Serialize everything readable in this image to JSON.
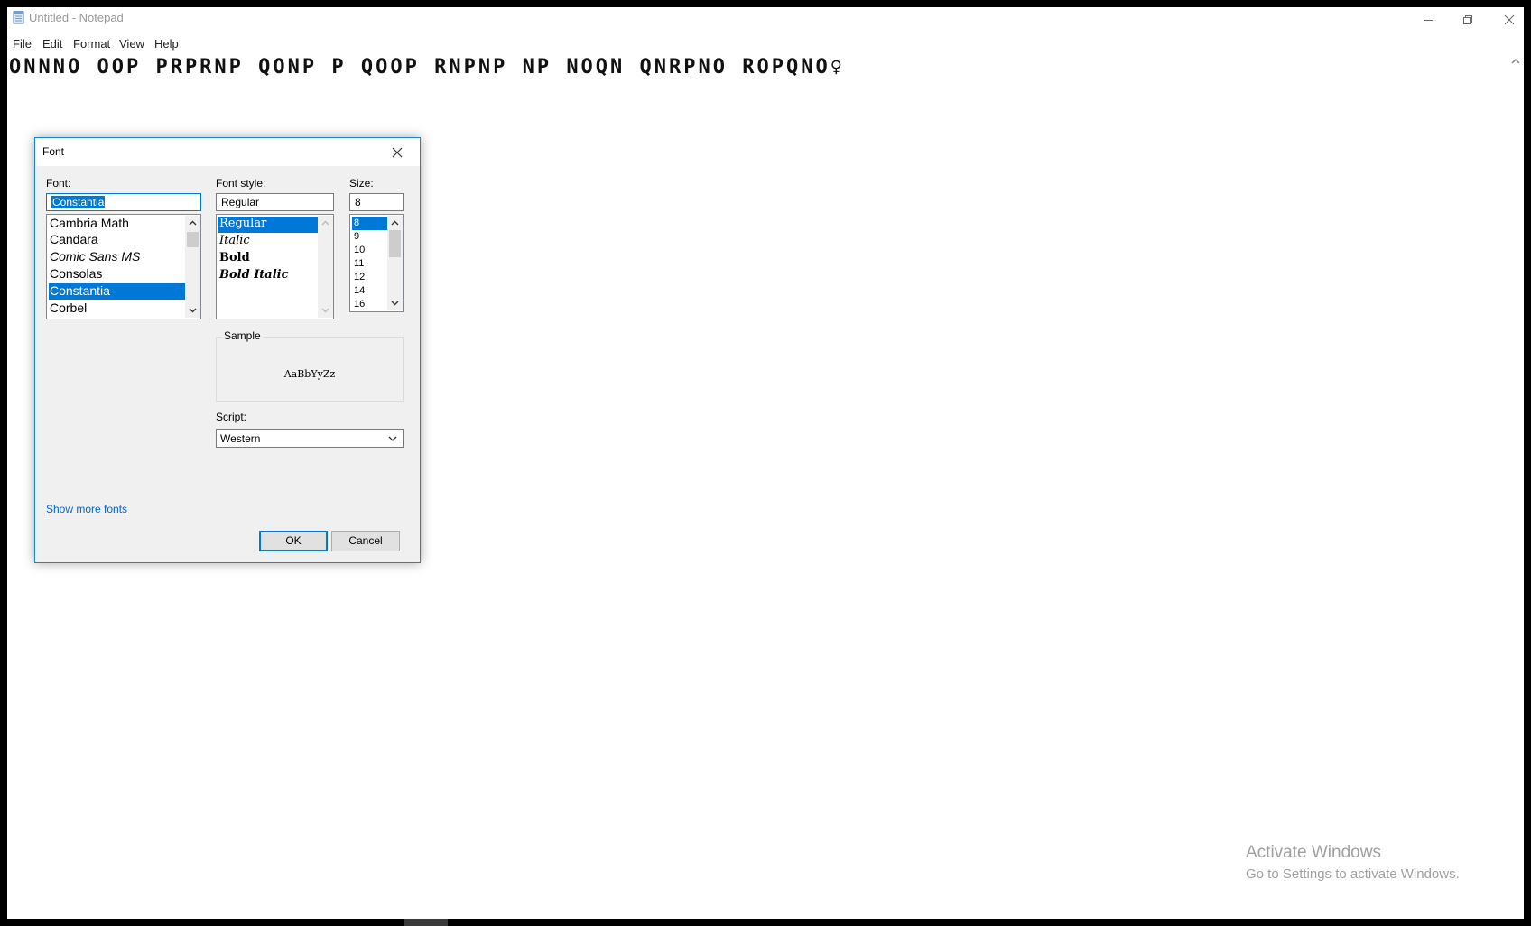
{
  "notepad": {
    "window_title": "Untitled - Notepad",
    "menu": [
      "File",
      "Edit",
      "Format",
      "View",
      "Help"
    ],
    "content": "ONNNO OOP PRPRNP QONP P QOOP RNPNP NP NOQN QNRPNO ROPQNO♀"
  },
  "font_dialog": {
    "title": "Font",
    "font_label": "Font:",
    "font_value": "Constantia",
    "fonts": [
      "Cambria Math",
      "Candara",
      "Comic Sans MS",
      "Consolas",
      "Constantia",
      "Corbel"
    ],
    "selected_font": "Constantia",
    "style_label": "Font style:",
    "style_value": "Regular",
    "styles": [
      "Regular",
      "Italic",
      "Bold",
      "Bold Italic"
    ],
    "selected_style": "Regular",
    "size_label": "Size:",
    "size_value": "8",
    "sizes": [
      "8",
      "9",
      "10",
      "11",
      "12",
      "14",
      "16"
    ],
    "selected_size": "8",
    "sample_label": "Sample",
    "sample_text": "AaBbYyZz",
    "script_label": "Script:",
    "script_value": "Western",
    "show_more_fonts": "Show more fonts",
    "ok_label": "OK",
    "cancel_label": "Cancel"
  },
  "watermark": {
    "title": "Activate Windows",
    "subtitle": "Go to Settings to activate Windows."
  },
  "colors": {
    "selection": "#0078d7",
    "dialog_bg": "#f0f0f0",
    "link": "#0066cc",
    "dialog_border": "#1883d7"
  },
  "icons": [
    "notepad-icon",
    "minimize-icon",
    "restore-icon",
    "close-icon",
    "scroll-up-icon",
    "scroll-down-icon",
    "chevron-down-icon"
  ]
}
